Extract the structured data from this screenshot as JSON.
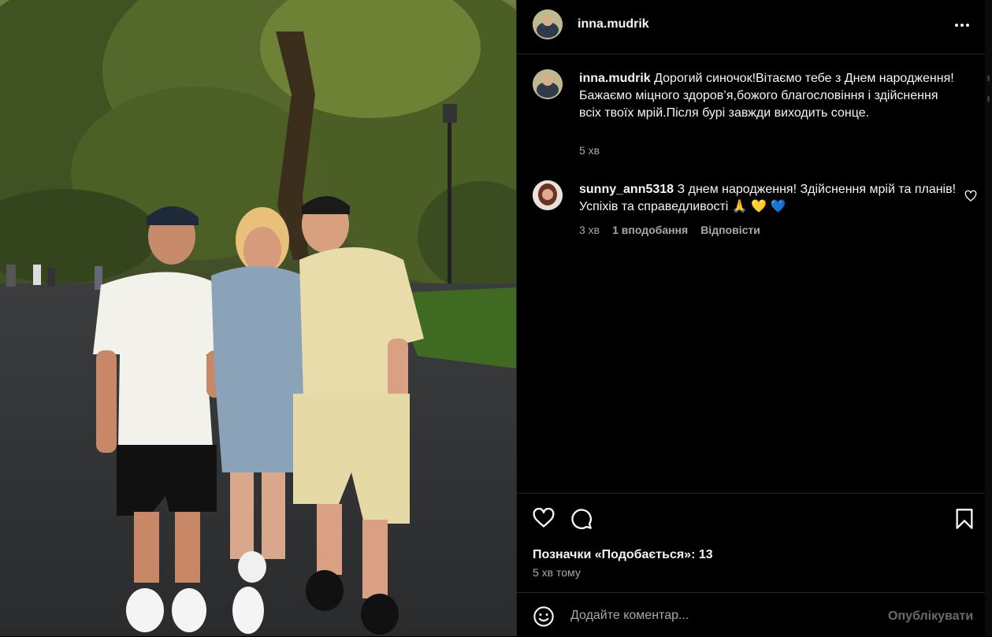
{
  "post": {
    "author": "inna.mudrik",
    "photo_alt": "",
    "caption": {
      "username": "inna.mudrik",
      "text": "Дорогий синочок!Вітаємо тебе з Днем народження!Бажаємо міцного здоров’я,божого благословіння і здійснення всіх твоїх мрій.Після бурі завжди виходить сонце.",
      "time": "5 хв"
    },
    "comments": [
      {
        "username": "sunny_ann5318",
        "text": "З днем народження! Здійснення мрій та планів! Успіхів та справедливості 🙏 💛 💙",
        "time": "3 хв",
        "likes": "1 вподобання",
        "reply": "Відповісти"
      }
    ],
    "likes_text": "Позначки «Подобається»: 13",
    "posted_time": "5 хв тому"
  },
  "add_comment": {
    "placeholder": "Додайте коментар...",
    "post_label": "Опублікувати"
  },
  "icons": {
    "more": "more-options-icon",
    "like": "heart-icon",
    "comment": "comment-icon",
    "save": "bookmark-icon",
    "emoji": "emoji-icon"
  },
  "colors": {
    "background": "#000000",
    "text": "#f5f5f5",
    "secondary_text": "#a8a8a8",
    "divider": "#262626",
    "disabled_button": "#6b6b6b"
  }
}
